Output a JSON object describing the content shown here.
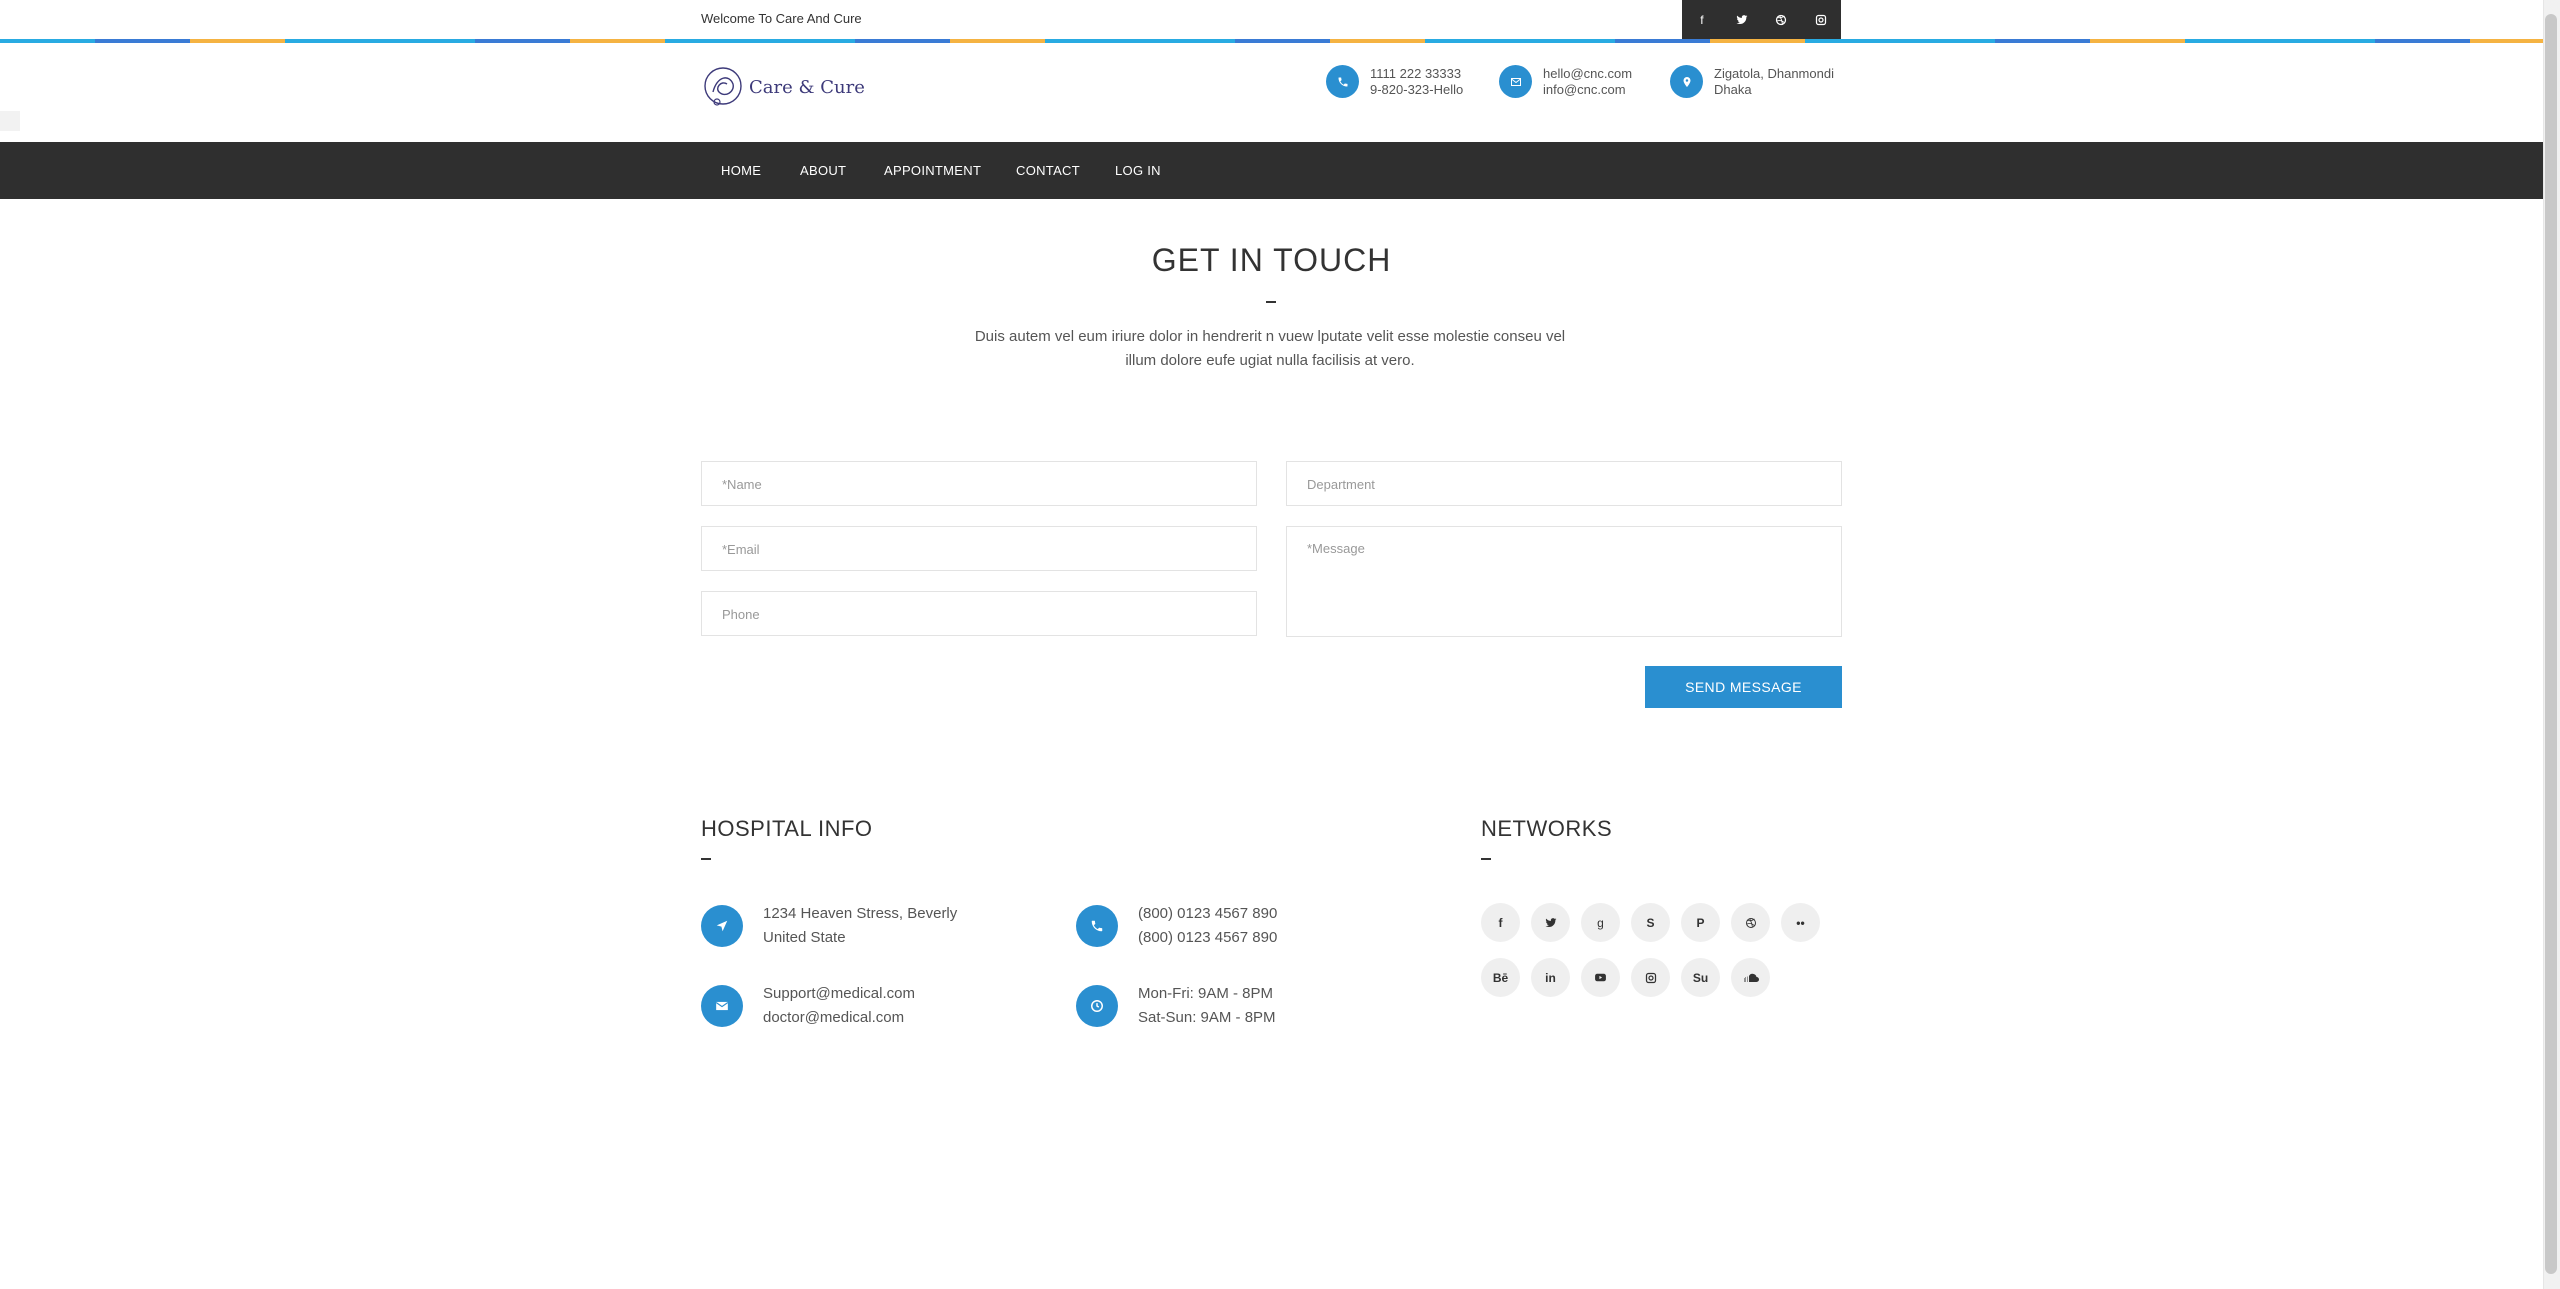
{
  "topbar": {
    "welcome": "Welcome To Care And Cure",
    "social": [
      {
        "icon": "facebook-icon",
        "glyph": "f"
      },
      {
        "icon": "twitter-icon",
        "glyph": "🐦"
      },
      {
        "icon": "dribbble-icon",
        "glyph": "◎"
      },
      {
        "icon": "instagram-icon",
        "glyph": "▣"
      }
    ]
  },
  "header": {
    "logo_text": "Care & Cure",
    "phone": {
      "line1": "1111 222 33333",
      "line2": "9-820-323-Hello"
    },
    "email": {
      "line1": "hello@cnc.com",
      "line2": "info@cnc.com"
    },
    "address": {
      "line1": "Zigatola, Dhanmondi",
      "line2": "Dhaka"
    }
  },
  "nav": {
    "items": [
      "HOME",
      "ABOUT",
      "APPOINTMENT",
      "CONTACT",
      "LOG IN"
    ]
  },
  "contact": {
    "title": "GET IN TOUCH",
    "desc_line1": "Duis autem vel eum iriure dolor in hendrerit n vuew lputate velit esse molestie conseu vel",
    "desc_line2": "illum dolore eufe ugiat nulla facilisis at vero.",
    "fields": {
      "name": "*Name",
      "department": "Department",
      "email": "*Email",
      "message": "*Message",
      "phone": "Phone"
    },
    "send_label": "SEND MESSAGE"
  },
  "hospital_info": {
    "title": "HOSPITAL INFO",
    "address": {
      "line1": "1234 Heaven Stress, Beverly",
      "line2": "United State"
    },
    "phone": {
      "line1": "(800) 0123 4567 890",
      "line2": "(800) 0123 4567 890"
    },
    "email": {
      "line1": "Support@medical.com",
      "line2": "doctor@medical.com"
    },
    "hours": {
      "line1": "Mon-Fri: 9AM - 8PM",
      "line2": "Sat-Sun: 9AM - 8PM"
    }
  },
  "networks": {
    "title": "NETWORKS",
    "row1": [
      {
        "icon": "facebook-icon",
        "glyph": "f"
      },
      {
        "icon": "twitter-icon",
        "glyph": "🐦"
      },
      {
        "icon": "google-plus-icon",
        "glyph": "g"
      },
      {
        "icon": "skype-icon",
        "glyph": "S"
      },
      {
        "icon": "pinterest-icon",
        "glyph": "P"
      },
      {
        "icon": "dribbble-icon",
        "glyph": "◎"
      },
      {
        "icon": "flickr-icon",
        "glyph": "••"
      }
    ],
    "row2": [
      {
        "icon": "behance-icon",
        "glyph": "Bē"
      },
      {
        "icon": "linkedin-icon",
        "glyph": "in"
      },
      {
        "icon": "youtube-icon",
        "glyph": "▶"
      },
      {
        "icon": "instagram-icon",
        "glyph": "▣"
      },
      {
        "icon": "stumbleupon-icon",
        "glyph": "Su"
      },
      {
        "icon": "soundcloud-icon",
        "glyph": "☁"
      }
    ]
  },
  "colors": {
    "accent": "#2a8fd0",
    "dark": "#2f2f2f"
  }
}
